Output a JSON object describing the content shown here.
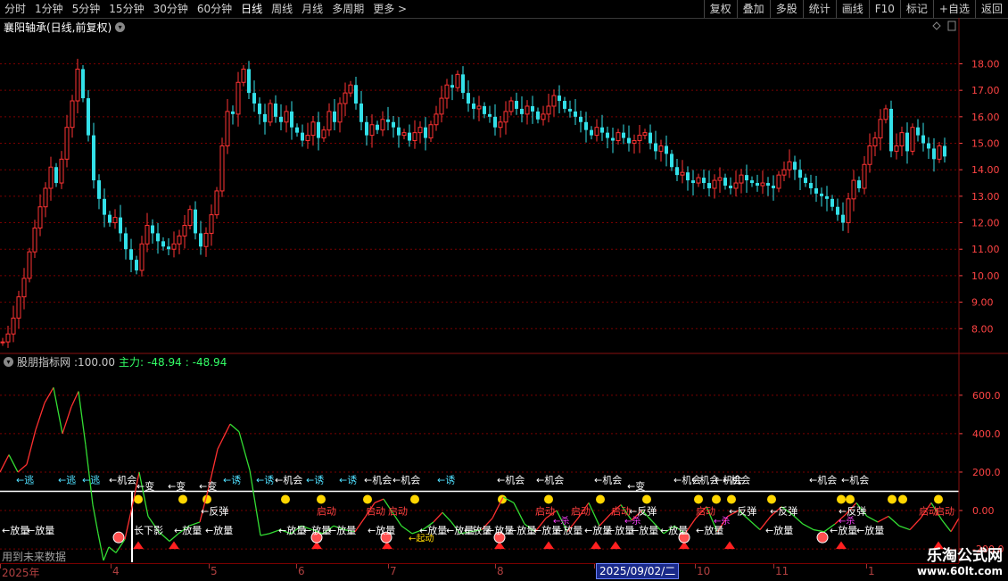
{
  "toolbar": {
    "periods": [
      "分时",
      "1分钟",
      "5分钟",
      "15分钟",
      "30分钟",
      "60分钟",
      "日线",
      "周线",
      "月线",
      "多周期",
      "更多 >"
    ],
    "active_period": "日线",
    "tools": [
      "复权",
      "叠加",
      "多股",
      "统计",
      "画线",
      "F10",
      "标记",
      "+自选",
      "返回"
    ]
  },
  "chart_header": {
    "title": "襄阳轴承(日线,前复权)"
  },
  "indicator_header": {
    "name": "股朋指标网",
    "value": ":100.00",
    "main_label": "主力:",
    "main_value": "-48.94",
    "main_value2": ": -48.94"
  },
  "future_data_label": "用到未来数据",
  "timeline": {
    "labels": [
      "2025年",
      "4",
      "5",
      "6",
      "7",
      "8",
      "9",
      "10",
      "11",
      "1"
    ],
    "highlight": "2025/09/02/二"
  },
  "watermark": {
    "name": "乐淘公式网",
    "url": "www.60lt.com"
  },
  "colors": {
    "up": "#ff3333",
    "down": "#33e0e8",
    "grid": "#7a0000",
    "axis": "#ff4444",
    "ind_line": "#33dd33",
    "marker": "#ffd700"
  },
  "chart_data": [
    {
      "type": "candlestick",
      "title": "襄阳轴承(日线,前复权)",
      "y_ticks": [
        8,
        9,
        10,
        11,
        12,
        13,
        14,
        15,
        16,
        17,
        18
      ],
      "y_tick_labels": [
        "8.00",
        "9.00",
        "10.00",
        "11.00",
        "12.00",
        "13.00",
        "14.00",
        "15.00",
        "16.00",
        "17.00",
        "18.00"
      ],
      "ylim": [
        7.2,
        19.6
      ],
      "x_labels": [
        "2025年",
        "4",
        "5",
        "6",
        "7",
        "8",
        "9",
        "10",
        "11",
        "1"
      ],
      "close_path": [
        [
          0,
          7.5
        ],
        [
          6,
          7.8
        ],
        [
          12,
          8.4
        ],
        [
          18,
          9.2
        ],
        [
          24,
          9.9
        ],
        [
          30,
          10.9
        ],
        [
          36,
          11.8
        ],
        [
          42,
          12.6
        ],
        [
          48,
          13.3
        ],
        [
          54,
          14.1
        ],
        [
          60,
          13.5
        ],
        [
          66,
          14.4
        ],
        [
          72,
          15.6
        ],
        [
          78,
          16.6
        ],
        [
          84,
          17.8
        ],
        [
          90,
          16.7
        ],
        [
          96,
          15.3
        ],
        [
          102,
          13.6
        ],
        [
          108,
          12.9
        ],
        [
          114,
          12.3
        ],
        [
          120,
          12.0
        ],
        [
          126,
          12.2
        ],
        [
          132,
          11.6
        ],
        [
          138,
          11.0
        ],
        [
          144,
          10.6
        ],
        [
          150,
          10.2
        ],
        [
          156,
          11.2
        ],
        [
          162,
          11.9
        ],
        [
          168,
          11.6
        ],
        [
          174,
          11.3
        ],
        [
          180,
          11.1
        ],
        [
          186,
          11.0
        ],
        [
          192,
          11.2
        ],
        [
          198,
          11.5
        ],
        [
          204,
          11.9
        ],
        [
          210,
          12.5
        ],
        [
          216,
          11.6
        ],
        [
          222,
          11.1
        ],
        [
          228,
          11.6
        ],
        [
          234,
          12.3
        ],
        [
          240,
          13.2
        ],
        [
          246,
          14.9
        ],
        [
          252,
          16.2
        ],
        [
          258,
          16.1
        ],
        [
          264,
          17.3
        ],
        [
          270,
          17.8
        ],
        [
          276,
          16.9
        ],
        [
          282,
          16.5
        ],
        [
          288,
          16.1
        ],
        [
          294,
          15.8
        ],
        [
          300,
          16.5
        ],
        [
          306,
          16.0
        ],
        [
          312,
          15.8
        ],
        [
          318,
          16.2
        ],
        [
          324,
          15.6
        ],
        [
          330,
          15.4
        ],
        [
          336,
          15.1
        ],
        [
          342,
          15.3
        ],
        [
          348,
          15.8
        ],
        [
          354,
          15.2
        ],
        [
          360,
          15.5
        ],
        [
          366,
          16.2
        ],
        [
          372,
          15.8
        ],
        [
          378,
          16.5
        ],
        [
          384,
          16.9
        ],
        [
          390,
          17.2
        ],
        [
          396,
          16.5
        ],
        [
          402,
          15.8
        ],
        [
          408,
          15.3
        ],
        [
          414,
          15.7
        ],
        [
          420,
          15.5
        ],
        [
          426,
          15.9
        ],
        [
          432,
          15.8
        ],
        [
          438,
          15.6
        ],
        [
          444,
          15.3
        ],
        [
          450,
          15.4
        ],
        [
          456,
          15.1
        ],
        [
          462,
          15.4
        ],
        [
          468,
          15.6
        ],
        [
          474,
          15.2
        ],
        [
          480,
          15.7
        ],
        [
          486,
          16.1
        ],
        [
          492,
          16.7
        ],
        [
          498,
          17.2
        ],
        [
          504,
          17.1
        ],
        [
          510,
          17.6
        ],
        [
          516,
          16.9
        ],
        [
          522,
          16.5
        ],
        [
          528,
          16.3
        ],
        [
          534,
          16.4
        ],
        [
          540,
          16.1
        ],
        [
          546,
          16.0
        ],
        [
          552,
          15.6
        ],
        [
          558,
          15.8
        ],
        [
          564,
          16.2
        ],
        [
          570,
          16.6
        ],
        [
          576,
          16.3
        ],
        [
          582,
          16.1
        ],
        [
          588,
          16.4
        ],
        [
          594,
          16.2
        ],
        [
          600,
          15.9
        ],
        [
          606,
          16.1
        ],
        [
          612,
          16.4
        ],
        [
          618,
          16.8
        ],
        [
          624,
          16.6
        ],
        [
          630,
          16.3
        ],
        [
          636,
          16.2
        ],
        [
          642,
          16.0
        ],
        [
          648,
          15.8
        ],
        [
          654,
          15.5
        ],
        [
          660,
          15.3
        ],
        [
          666,
          15.6
        ],
        [
          672,
          15.4
        ],
        [
          678,
          15.2
        ],
        [
          684,
          15.1
        ],
        [
          690,
          15.4
        ],
        [
          696,
          15.2
        ],
        [
          702,
          15.0
        ],
        [
          708,
          15.1
        ],
        [
          714,
          15.3
        ],
        [
          720,
          15.4
        ],
        [
          726,
          15.0
        ],
        [
          732,
          14.7
        ],
        [
          738,
          14.9
        ],
        [
          744,
          14.6
        ],
        [
          750,
          14.1
        ],
        [
          756,
          13.8
        ],
        [
          762,
          13.9
        ],
        [
          768,
          13.6
        ],
        [
          774,
          13.5
        ],
        [
          780,
          13.7
        ],
        [
          786,
          13.5
        ],
        [
          792,
          13.3
        ],
        [
          798,
          13.6
        ],
        [
          804,
          13.7
        ],
        [
          810,
          13.4
        ],
        [
          816,
          13.3
        ],
        [
          822,
          13.5
        ],
        [
          828,
          13.8
        ],
        [
          834,
          13.6
        ],
        [
          840,
          13.5
        ],
        [
          846,
          13.4
        ],
        [
          852,
          13.5
        ],
        [
          858,
          13.4
        ],
        [
          864,
          13.3
        ],
        [
          870,
          13.8
        ],
        [
          876,
          14.0
        ],
        [
          882,
          14.3
        ],
        [
          888,
          14.0
        ],
        [
          894,
          13.7
        ],
        [
          900,
          13.5
        ],
        [
          906,
          13.3
        ],
        [
          912,
          13.1
        ],
        [
          918,
          13.0
        ],
        [
          924,
          12.9
        ],
        [
          930,
          12.6
        ],
        [
          936,
          12.3
        ],
        [
          942,
          12.0
        ],
        [
          948,
          12.9
        ],
        [
          954,
          13.6
        ],
        [
          960,
          13.3
        ],
        [
          966,
          14.2
        ],
        [
          972,
          14.9
        ],
        [
          978,
          15.2
        ],
        [
          984,
          15.9
        ],
        [
          990,
          16.3
        ],
        [
          996,
          14.7
        ],
        [
          1002,
          14.9
        ],
        [
          1008,
          15.4
        ],
        [
          1014,
          14.7
        ],
        [
          1020,
          15.6
        ],
        [
          1026,
          15.3
        ],
        [
          1032,
          15.0
        ],
        [
          1038,
          14.8
        ],
        [
          1044,
          14.4
        ],
        [
          1050,
          14.9
        ],
        [
          1056,
          14.5
        ]
      ]
    },
    {
      "type": "line",
      "title": "股朋指标网",
      "y_ticks": [
        600,
        400,
        200,
        0,
        -200
      ],
      "y_tick_labels": [
        "600.0",
        "400.0",
        "200.0",
        "0.00",
        "-200.0"
      ],
      "ylim": [
        -260,
        720
      ],
      "series": [
        {
          "name": "主力",
          "points": [
            [
              0,
              200
            ],
            [
              10,
              290
            ],
            [
              20,
              200
            ],
            [
              30,
              240
            ],
            [
              40,
              420
            ],
            [
              50,
              560
            ],
            [
              60,
              640
            ],
            [
              70,
              400
            ],
            [
              80,
              540
            ],
            [
              88,
              620
            ],
            [
              96,
              340
            ],
            [
              104,
              30
            ],
            [
              110,
              -120
            ],
            [
              116,
              -260
            ],
            [
              122,
              -190
            ],
            [
              130,
              -220
            ],
            [
              140,
              -150
            ],
            [
              150,
              60
            ],
            [
              156,
              200
            ],
            [
              166,
              -30
            ],
            [
              178,
              -110
            ],
            [
              190,
              -160
            ],
            [
              200,
              -120
            ],
            [
              212,
              -80
            ],
            [
              224,
              -60
            ],
            [
              234,
              120
            ],
            [
              244,
              320
            ],
            [
              258,
              450
            ],
            [
              268,
              410
            ],
            [
              280,
              210
            ],
            [
              292,
              -130
            ],
            [
              302,
              -120
            ],
            [
              314,
              -100
            ],
            [
              326,
              -120
            ],
            [
              338,
              -80
            ],
            [
              350,
              -100
            ],
            [
              362,
              -120
            ],
            [
              374,
              -80
            ],
            [
              386,
              -100
            ],
            [
              398,
              -110
            ],
            [
              410,
              -30
            ],
            [
              420,
              40
            ],
            [
              430,
              60
            ],
            [
              440,
              -10
            ],
            [
              450,
              -80
            ],
            [
              462,
              -120
            ],
            [
              474,
              -100
            ],
            [
              486,
              -60
            ],
            [
              496,
              -10
            ],
            [
              506,
              -60
            ],
            [
              516,
              -120
            ],
            [
              528,
              -110
            ],
            [
              540,
              -100
            ],
            [
              552,
              -40
            ],
            [
              564,
              70
            ],
            [
              576,
              40
            ],
            [
              588,
              -70
            ],
            [
              600,
              -110
            ],
            [
              612,
              -40
            ],
            [
              624,
              0
            ],
            [
              636,
              -110
            ],
            [
              648,
              -40
            ],
            [
              660,
              40
            ],
            [
              672,
              -80
            ],
            [
              684,
              -20
            ],
            [
              696,
              30
            ],
            [
              708,
              -50
            ],
            [
              720,
              0
            ],
            [
              732,
              -60
            ],
            [
              744,
              -120
            ],
            [
              756,
              -80
            ],
            [
              768,
              -120
            ],
            [
              780,
              -40
            ],
            [
              792,
              20
            ],
            [
              804,
              -110
            ],
            [
              816,
              -30
            ],
            [
              828,
              0
            ],
            [
              840,
              -50
            ],
            [
              852,
              -100
            ],
            [
              864,
              -30
            ],
            [
              876,
              20
            ],
            [
              888,
              -20
            ],
            [
              900,
              -70
            ],
            [
              912,
              -100
            ],
            [
              924,
              -110
            ],
            [
              936,
              -70
            ],
            [
              948,
              -20
            ],
            [
              960,
              40
            ],
            [
              972,
              -30
            ],
            [
              984,
              -60
            ],
            [
              996,
              -30
            ],
            [
              1008,
              -80
            ],
            [
              1020,
              -100
            ],
            [
              1032,
              -40
            ],
            [
              1044,
              40
            ],
            [
              1056,
              -50
            ],
            [
              1066,
              -110
            ],
            [
              1075,
              -40
            ]
          ]
        }
      ],
      "annotations": {
        "top_labels": [
          "←逃",
          "←逃",
          "←逃",
          "←机会",
          "←变",
          "←变",
          "←变",
          "←诱",
          "←诱",
          "←机会",
          "←诱",
          "←诱",
          "←机会",
          "←机会",
          "←诱",
          "←机会",
          "←机会",
          "←机会",
          "←变",
          "←机会",
          "←机会",
          "←机会",
          "←机会",
          "←机会",
          "←机会"
        ],
        "bottom_labels": [
          "←放量",
          "←放量",
          "长下影",
          "←放量",
          "←放量",
          "←放量",
          "←放量",
          "←放量",
          "←放量",
          "←放量",
          "←放量",
          "←放量",
          "←放量",
          "←放量",
          "←放量",
          "←放量",
          "←放量",
          "←放量",
          "←放量",
          "←放量",
          "←放量",
          "←放量",
          "←放量",
          "←放量"
        ],
        "mid_labels": [
          "←反弹",
          "←反弹",
          "←反弹",
          "←反弹",
          "←反弹"
        ],
        "red_labels": [
          "启动",
          "启动",
          "启动",
          "启动",
          "启动",
          "启动",
          "启动",
          "启动",
          "启动"
        ],
        "pink_labels": [
          "←杀",
          "←杀",
          "←杀",
          "←杀"
        ],
        "vertical_label": "←起动"
      }
    }
  ]
}
